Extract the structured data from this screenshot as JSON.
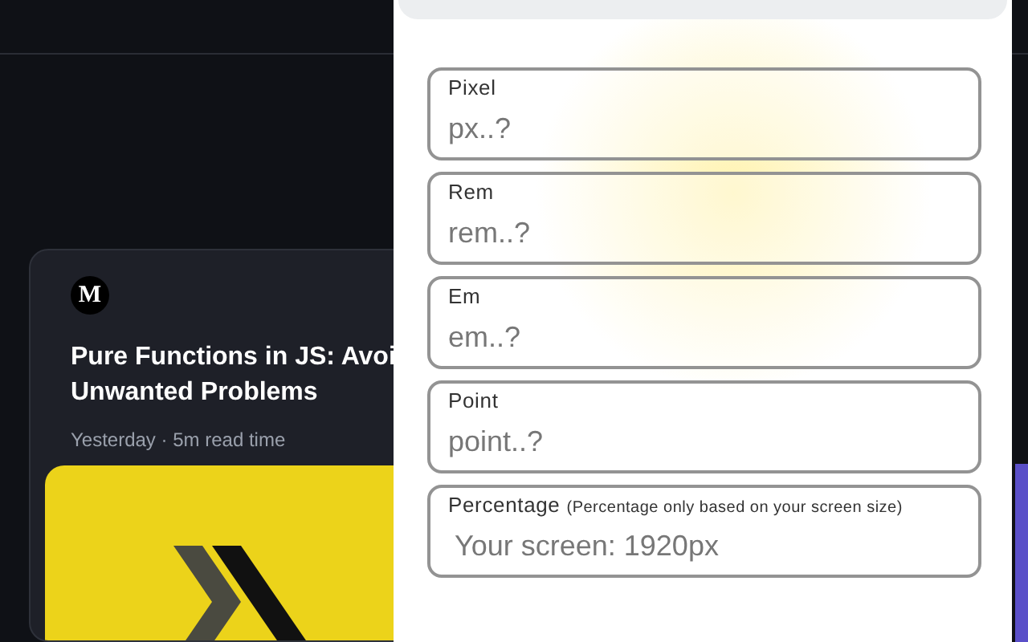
{
  "article_card": {
    "source_logo": "M",
    "title": "Pure Functions in JS: Avoi Unwanted Problems",
    "meta": "Yesterday · 5m read time"
  },
  "converter": {
    "fields": [
      {
        "label": "Pixel",
        "placeholder": "px..?"
      },
      {
        "label": "Rem",
        "placeholder": "rem..?"
      },
      {
        "label": "Em",
        "placeholder": "em..?"
      },
      {
        "label": "Point",
        "placeholder": "point..?"
      },
      {
        "label": "Percentage",
        "note": "(Percentage only based on your screen size)",
        "placeholder": "Your screen: 1920px"
      }
    ]
  }
}
